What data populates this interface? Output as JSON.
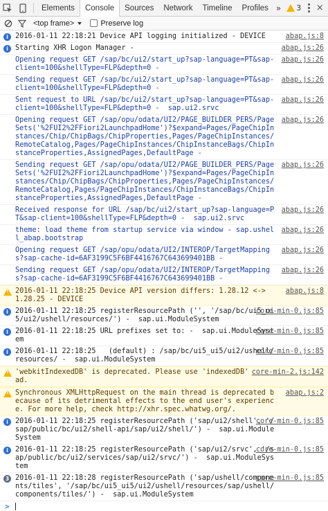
{
  "toolbar": {
    "tabs": [
      "Elements",
      "Console",
      "Sources",
      "Network",
      "Timeline",
      "Profiles"
    ],
    "active_tab": "Console",
    "more_label": "»",
    "warning_count": "3",
    "close_label": "×"
  },
  "filterbar": {
    "context": "<top frame>",
    "preserve_log_label": "Preserve log"
  },
  "messages": [
    {
      "level": "info",
      "text": "2016-01-11 22:18:21 Device API logging initialized - DEVICE",
      "source": "abap.js:8"
    },
    {
      "level": "info",
      "text": "Starting XHR Logon Manager -",
      "source": "abap.js:26"
    },
    {
      "level": "log",
      "text": "Opening request GET /sap/bc/ui2/start_up?sap-language=PT&sap-client=100&shellType=FLP&depth=0 -",
      "source": "abap.js:26"
    },
    {
      "level": "log",
      "text": "Sending request GET /sap/bc/ui2/start_up?sap-language=PT&sap-client=100&shellType=FLP&depth=0 -",
      "source": "abap.js:26"
    },
    {
      "level": "log",
      "text": "Sent request to URL /sap/bc/ui2/start_up?sap-language=PT&sap-client=100&shellType=FLP&depth=0 -  sap.ui2.srvc",
      "source": "abap.js:26"
    },
    {
      "level": "log",
      "text": "Opening request GET /sap/opu/odata/UI2/PAGE_BUILDER_PERS/PageSets('%2FUI2%2FFiori2LaunchpadHome')?$expand=Pages/PageChipInstances/Chip/ChipBags/ChipProperties,Pages/PageChipInstances/RemoteCatalog,Pages/PageChipInstances/ChipInstanceBags/ChipInstanceProperties,AssignedPages,DefaultPage -",
      "source": "abap.js:26"
    },
    {
      "level": "log",
      "text": "Sending request GET /sap/opu/odata/UI2/PAGE_BUILDER_PERS/PageSets('%2FUI2%2FFiori2LaunchpadHome')?$expand=Pages/PageChipInstances/Chip/ChipBags/ChipProperties,Pages/PageChipInstances/RemoteCatalog,Pages/PageChipInstances/ChipInstanceBags/ChipInstanceProperties,AssignedPages,DefaultPage -",
      "source": "abap.js:26"
    },
    {
      "level": "log",
      "text": "Received response for URL /sap/bc/ui2/start_up?sap-language=PT&sap-client=100&shellType=FLP&depth=0 -  sap.ui2.srvc",
      "source": "abap.js:26"
    },
    {
      "level": "log",
      "text": "theme: load theme from startup service via window - sap.ushell_abap.bootstrap",
      "source": "abap.js:26"
    },
    {
      "level": "log",
      "text": "Opening request GET /sap/opu/odata/UI2/INTEROP/TargetMappings?sap-cache-id=6AF3199C5F6BF4416767C643699401BB -",
      "source": "abap.js:26"
    },
    {
      "level": "log",
      "text": "Sending request GET /sap/opu/odata/UI2/INTEROP/TargetMappings?sap-cache-id=6AF3199C5F6BF4416767C643699401BB -",
      "source": "abap.js:26"
    },
    {
      "level": "warn",
      "text": "2016-01-11 22:18:25 Device API version differs: 1.28.12 <-> 1.28.25 - DEVICE",
      "source": "abap.js:8"
    },
    {
      "level": "info",
      "text": "2016-01-11 22:18:25 registerResourcePath ('', '/sap/bc/ui5_ui5/ui2/ushell/resources/') -  sap.ui.ModuleSystem",
      "source": "core-min-0.js:85"
    },
    {
      "level": "info",
      "text": "2016-01-11 22:18:25 URL prefixes set to: -  sap.ui.ModuleSystem",
      "source": "core-min-0.js:85"
    },
    {
      "level": "info",
      "text": "2016-01-11 22:18:25   (default) : /sap/bc/ui5_ui5/ui2/ushell/resources/ -  sap.ui.ModuleSystem",
      "source": "core-min-0.js:85"
    },
    {
      "level": "warn",
      "text": "'webkitIndexedDB' is deprecated. Please use 'indexedDB' instead.",
      "source": "core-min-2.js:142"
    },
    {
      "level": "warn",
      "text": "Synchronous XMLHttpRequest on the main thread is deprecated because of its detrimental effects to the end user's experience. For more help, check http://xhr.spec.whatwg.org/.",
      "source": "abap.js:2"
    },
    {
      "level": "info",
      "text": "2016-01-11 22:18:25 registerResourcePath ('sap/ui2/shell', '/sap/public/bc/ui2/shell-api/sap/ui2/shell/') -  sap.ui.ModuleSystem",
      "source": "core-min-0.js:85"
    },
    {
      "level": "info",
      "text": "2016-01-11 22:18:25 registerResourcePath ('sap/ui2/srvc', '/sap/public/bc/ui2/services/sap/ui2/srvc/') -  sap.ui.ModuleSystem",
      "source": "core-min-0.js:85"
    },
    {
      "level": "count",
      "count": "3",
      "text": "2016-01-11 22:18:28 registerResourcePath ('sap/ushell/components/tiles', '/sap/bc/ui5_ui5/ui2/ushell/resources/sap/ushell/components/tiles/') -  sap.ui.ModuleSystem",
      "source": "core-min-0.js:85"
    }
  ]
}
